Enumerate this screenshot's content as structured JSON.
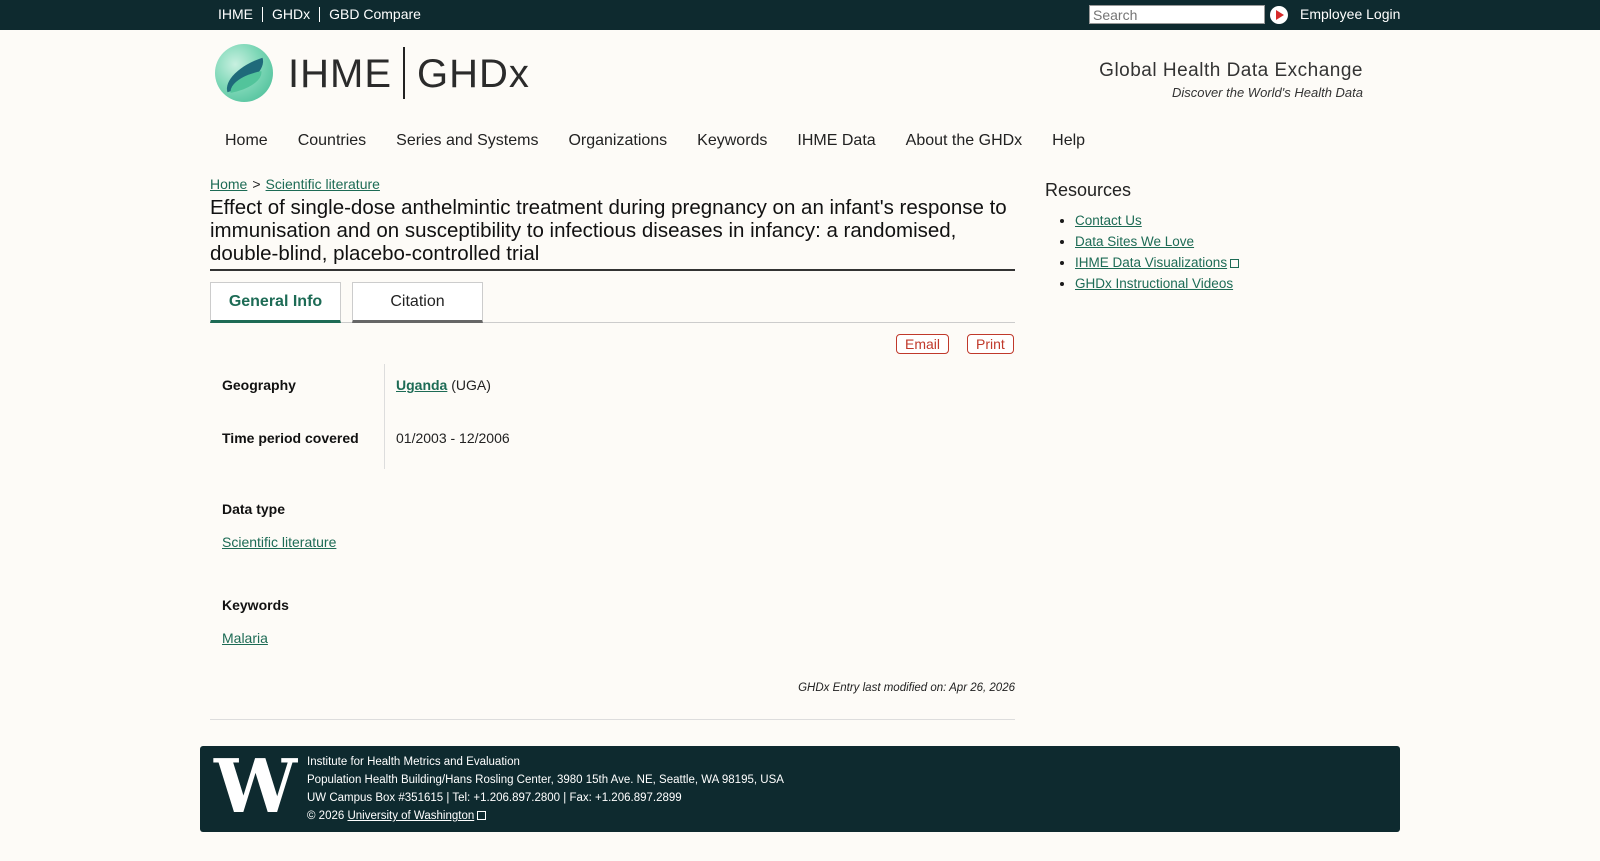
{
  "topbar": {
    "links": [
      "IHME",
      "GHDx",
      "GBD Compare"
    ],
    "search_placeholder": "Search",
    "login": "Employee Login"
  },
  "header": {
    "brand_left": "IHME",
    "brand_right": "GHDx",
    "tagline": "Global Health Data Exchange",
    "subtagline": "Discover the World's Health Data"
  },
  "mainnav": [
    "Home",
    "Countries",
    "Series and Systems",
    "Organizations",
    "Keywords",
    "IHME Data",
    "About the GHDx",
    "Help"
  ],
  "breadcrumb": {
    "home": "Home",
    "sep": ">",
    "section": "Scientific literature"
  },
  "title": "Effect of single-dose anthelmintic treatment during pregnancy on an infant's response to immunisation and on susceptibility to infectious diseases in infancy: a randomised, double-blind, placebo-controlled trial",
  "tabs": {
    "general": "General Info",
    "citation": "Citation"
  },
  "actions": {
    "email": "Email",
    "print": "Print"
  },
  "info": {
    "geography_label": "Geography",
    "geography_country": "Uganda",
    "geography_code": "(UGA)",
    "time_label": "Time period covered",
    "time_value": "01/2003 - 12/2006",
    "datatype_label": "Data type",
    "datatype_value": "Scientific literature",
    "keywords_label": "Keywords",
    "keywords_value": "Malaria"
  },
  "modified": "GHDx Entry last modified on: Apr 26, 2026",
  "resources": {
    "title": "Resources",
    "items": [
      "Contact Us",
      "Data Sites We Love",
      "IHME Data Visualizations",
      "GHDx Instructional Videos"
    ]
  },
  "footer": {
    "logo_letter": "W",
    "line1": "Institute for Health Metrics and Evaluation",
    "line2": "Population Health Building/Hans Rosling Center, 3980 15th Ave. NE, Seattle, WA 98195, USA",
    "line3": "UW Campus Box #351615 | Tel: +1.206.897.2800 | Fax: +1.206.897.2899",
    "copyright": "© 2026",
    "uw_link": "University of Washington"
  }
}
